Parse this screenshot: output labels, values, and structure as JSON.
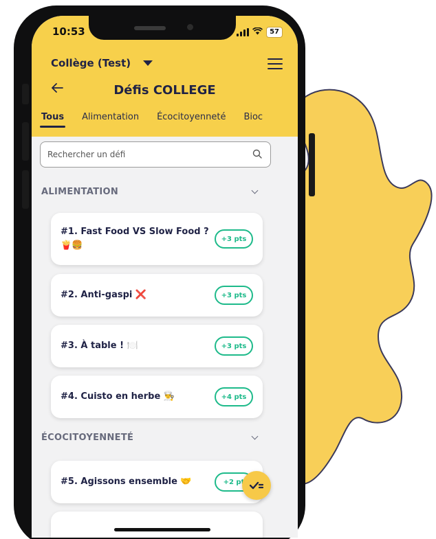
{
  "status_bar": {
    "time": "10:53",
    "battery": "57"
  },
  "header": {
    "school_select_value": "Collège (Test)",
    "title": "Défis COLLEGE"
  },
  "tabs": [
    {
      "label": "Tous"
    },
    {
      "label": "Alimentation"
    },
    {
      "label": "Écocitoyenneté"
    },
    {
      "label": "Bioc"
    }
  ],
  "search": {
    "placeholder": "Rechercher un défi"
  },
  "sections": [
    {
      "title": "ALIMENTATION",
      "challenges": [
        {
          "title": "#1. Fast Food VS Slow Food ? 🍟🍔",
          "points": "+3 pts"
        },
        {
          "title": "#2. Anti-gaspi ❌",
          "points": "+3 pts"
        },
        {
          "title": "#3. À table ! 🍽️",
          "points": "+3 pts"
        },
        {
          "title": "#4. Cuisto en herbe 👨‍🍳",
          "points": "+4 pts"
        }
      ]
    },
    {
      "title": "ÉCOCITOYENNETÉ",
      "challenges": [
        {
          "title": "#5. Agissons ensemble 🤝",
          "points": "+2 pt"
        }
      ]
    }
  ],
  "colors": {
    "header_yellow": "#f7d04b",
    "navy": "#1f2245",
    "points_green": "#1dba8a",
    "blob_yellow": "#f8cf58",
    "blob_outline": "#3b3a5a"
  },
  "icons": {
    "fab": "checklist-icon",
    "back": "arrow-left-icon",
    "menu": "hamburger-menu-icon",
    "search": "search-icon"
  }
}
